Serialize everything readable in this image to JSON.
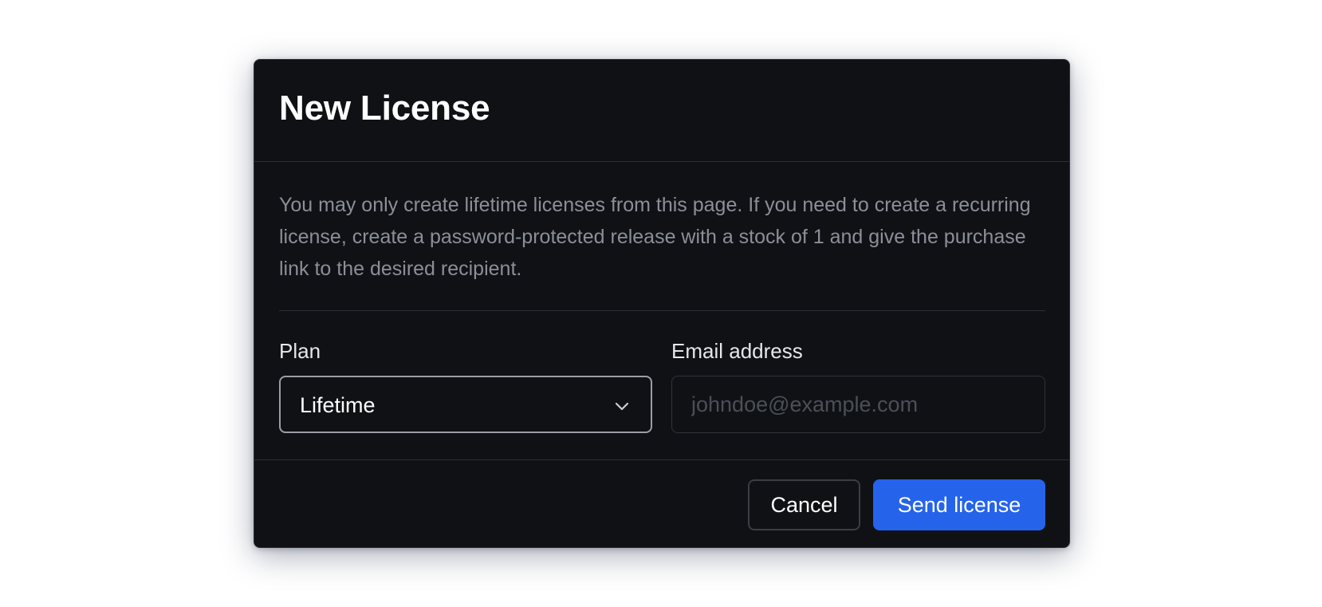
{
  "dialog": {
    "title": "New License",
    "description": "You may only create lifetime licenses from this page. If you need to create a recurring license, create a password-protected release with a stock of 1 and give the purchase link to the desired recipient."
  },
  "form": {
    "plan": {
      "label": "Plan",
      "selected": "Lifetime",
      "icon": "chevron-down-icon"
    },
    "email": {
      "label": "Email address",
      "value": "",
      "placeholder": "johndoe@example.com"
    }
  },
  "footer": {
    "cancel_label": "Cancel",
    "send_label": "Send license"
  },
  "colors": {
    "dialog_background": "#0f1115",
    "primary_button": "#2563eb",
    "description_text": "#8b8f98",
    "placeholder_text": "#4b4f57"
  }
}
